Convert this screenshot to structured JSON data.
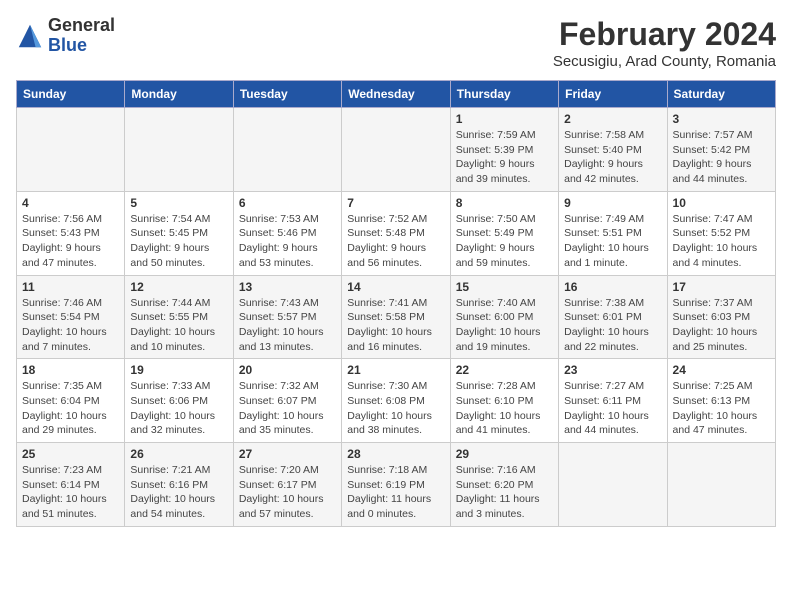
{
  "header": {
    "logo_general": "General",
    "logo_blue": "Blue",
    "month_title": "February 2024",
    "location": "Secusigiu, Arad County, Romania"
  },
  "days_of_week": [
    "Sunday",
    "Monday",
    "Tuesday",
    "Wednesday",
    "Thursday",
    "Friday",
    "Saturday"
  ],
  "weeks": [
    [
      {
        "day": "",
        "info": ""
      },
      {
        "day": "",
        "info": ""
      },
      {
        "day": "",
        "info": ""
      },
      {
        "day": "",
        "info": ""
      },
      {
        "day": "1",
        "info": "Sunrise: 7:59 AM\nSunset: 5:39 PM\nDaylight: 9 hours\nand 39 minutes."
      },
      {
        "day": "2",
        "info": "Sunrise: 7:58 AM\nSunset: 5:40 PM\nDaylight: 9 hours\nand 42 minutes."
      },
      {
        "day": "3",
        "info": "Sunrise: 7:57 AM\nSunset: 5:42 PM\nDaylight: 9 hours\nand 44 minutes."
      }
    ],
    [
      {
        "day": "4",
        "info": "Sunrise: 7:56 AM\nSunset: 5:43 PM\nDaylight: 9 hours\nand 47 minutes."
      },
      {
        "day": "5",
        "info": "Sunrise: 7:54 AM\nSunset: 5:45 PM\nDaylight: 9 hours\nand 50 minutes."
      },
      {
        "day": "6",
        "info": "Sunrise: 7:53 AM\nSunset: 5:46 PM\nDaylight: 9 hours\nand 53 minutes."
      },
      {
        "day": "7",
        "info": "Sunrise: 7:52 AM\nSunset: 5:48 PM\nDaylight: 9 hours\nand 56 minutes."
      },
      {
        "day": "8",
        "info": "Sunrise: 7:50 AM\nSunset: 5:49 PM\nDaylight: 9 hours\nand 59 minutes."
      },
      {
        "day": "9",
        "info": "Sunrise: 7:49 AM\nSunset: 5:51 PM\nDaylight: 10 hours\nand 1 minute."
      },
      {
        "day": "10",
        "info": "Sunrise: 7:47 AM\nSunset: 5:52 PM\nDaylight: 10 hours\nand 4 minutes."
      }
    ],
    [
      {
        "day": "11",
        "info": "Sunrise: 7:46 AM\nSunset: 5:54 PM\nDaylight: 10 hours\nand 7 minutes."
      },
      {
        "day": "12",
        "info": "Sunrise: 7:44 AM\nSunset: 5:55 PM\nDaylight: 10 hours\nand 10 minutes."
      },
      {
        "day": "13",
        "info": "Sunrise: 7:43 AM\nSunset: 5:57 PM\nDaylight: 10 hours\nand 13 minutes."
      },
      {
        "day": "14",
        "info": "Sunrise: 7:41 AM\nSunset: 5:58 PM\nDaylight: 10 hours\nand 16 minutes."
      },
      {
        "day": "15",
        "info": "Sunrise: 7:40 AM\nSunset: 6:00 PM\nDaylight: 10 hours\nand 19 minutes."
      },
      {
        "day": "16",
        "info": "Sunrise: 7:38 AM\nSunset: 6:01 PM\nDaylight: 10 hours\nand 22 minutes."
      },
      {
        "day": "17",
        "info": "Sunrise: 7:37 AM\nSunset: 6:03 PM\nDaylight: 10 hours\nand 25 minutes."
      }
    ],
    [
      {
        "day": "18",
        "info": "Sunrise: 7:35 AM\nSunset: 6:04 PM\nDaylight: 10 hours\nand 29 minutes."
      },
      {
        "day": "19",
        "info": "Sunrise: 7:33 AM\nSunset: 6:06 PM\nDaylight: 10 hours\nand 32 minutes."
      },
      {
        "day": "20",
        "info": "Sunrise: 7:32 AM\nSunset: 6:07 PM\nDaylight: 10 hours\nand 35 minutes."
      },
      {
        "day": "21",
        "info": "Sunrise: 7:30 AM\nSunset: 6:08 PM\nDaylight: 10 hours\nand 38 minutes."
      },
      {
        "day": "22",
        "info": "Sunrise: 7:28 AM\nSunset: 6:10 PM\nDaylight: 10 hours\nand 41 minutes."
      },
      {
        "day": "23",
        "info": "Sunrise: 7:27 AM\nSunset: 6:11 PM\nDaylight: 10 hours\nand 44 minutes."
      },
      {
        "day": "24",
        "info": "Sunrise: 7:25 AM\nSunset: 6:13 PM\nDaylight: 10 hours\nand 47 minutes."
      }
    ],
    [
      {
        "day": "25",
        "info": "Sunrise: 7:23 AM\nSunset: 6:14 PM\nDaylight: 10 hours\nand 51 minutes."
      },
      {
        "day": "26",
        "info": "Sunrise: 7:21 AM\nSunset: 6:16 PM\nDaylight: 10 hours\nand 54 minutes."
      },
      {
        "day": "27",
        "info": "Sunrise: 7:20 AM\nSunset: 6:17 PM\nDaylight: 10 hours\nand 57 minutes."
      },
      {
        "day": "28",
        "info": "Sunrise: 7:18 AM\nSunset: 6:19 PM\nDaylight: 11 hours\nand 0 minutes."
      },
      {
        "day": "29",
        "info": "Sunrise: 7:16 AM\nSunset: 6:20 PM\nDaylight: 11 hours\nand 3 minutes."
      },
      {
        "day": "",
        "info": ""
      },
      {
        "day": "",
        "info": ""
      }
    ]
  ]
}
